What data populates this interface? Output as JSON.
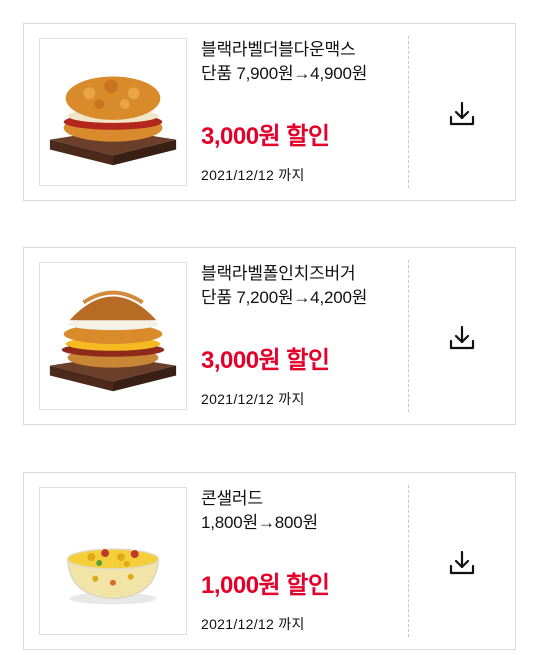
{
  "coupons": [
    {
      "product_name": "블랙라벨더블다운맥스",
      "price_text": "단품 7,900원→4,900원",
      "discount_text": "3,000원 할인",
      "expiry_text": "2021/12/12 까지",
      "icon": "download-icon"
    },
    {
      "product_name": "블랙라벨폴인치즈버거",
      "price_text": "단품 7,200원→4,200원",
      "discount_text": "3,000원 할인",
      "expiry_text": "2021/12/12 까지",
      "icon": "download-icon"
    },
    {
      "product_name": "콘샐러드",
      "price_text": "1,800원→800원",
      "discount_text": "1,000원 할인",
      "expiry_text": "2021/12/12 까지",
      "icon": "download-icon"
    }
  ],
  "colors": {
    "discount": "#e4002b",
    "border": "#d9d9d9",
    "text": "#111111"
  }
}
